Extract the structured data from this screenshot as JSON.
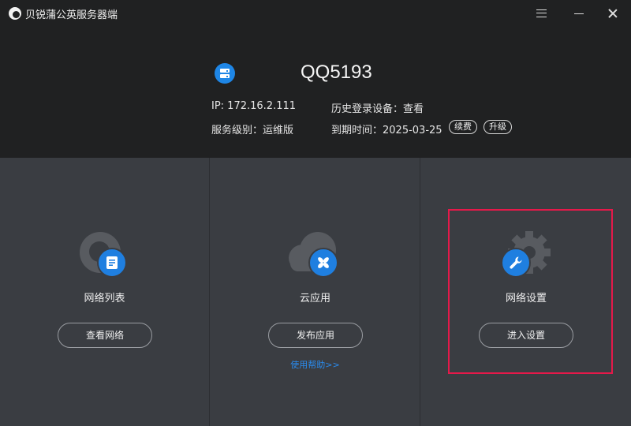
{
  "window": {
    "title": "贝锐蒲公英服务器端"
  },
  "device": {
    "id": "QQ5193",
    "ip": "IP: 172.16.2.111",
    "service_level": "服务级别：运维版",
    "history_devices": "历史登录设备：查看",
    "expire": "到期时间：2025-03-25",
    "renew_label": "续费",
    "upgrade_label": "升级"
  },
  "features": [
    {
      "label": "网络列表",
      "button": "查看网络",
      "icon": "network-list-icon"
    },
    {
      "label": "云应用",
      "button": "发布应用",
      "icon": "cloud-app-icon",
      "help_link": "使用帮助>>"
    },
    {
      "label": "网络设置",
      "button": "进入设置",
      "icon": "network-settings-icon"
    }
  ],
  "colors": {
    "accent": "#1f7fe0",
    "highlight": "#e5194a",
    "header_bg": "#202122",
    "panel_bg": "#3a3d42",
    "link": "#2a8cf0"
  }
}
